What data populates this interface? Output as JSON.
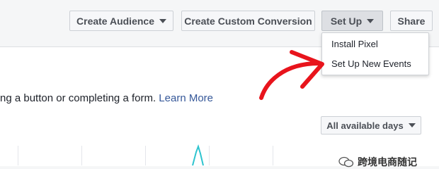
{
  "toolbar": {
    "create_audience": "Create Audience",
    "create_custom_conversion": "Create Custom Conversion",
    "set_up": "Set Up",
    "share": "Share"
  },
  "setup_menu": {
    "items": [
      "Install Pixel",
      "Set Up New Events"
    ]
  },
  "description": {
    "text": "ng a button or completing a form.",
    "link": "Learn More"
  },
  "date_filter": {
    "selected": "All available days"
  },
  "watermark": {
    "text": "跨境电商随记"
  },
  "colors": {
    "link": "#365899",
    "annotation_arrow": "#e8141c",
    "chart_line": "#2ec4cf"
  }
}
